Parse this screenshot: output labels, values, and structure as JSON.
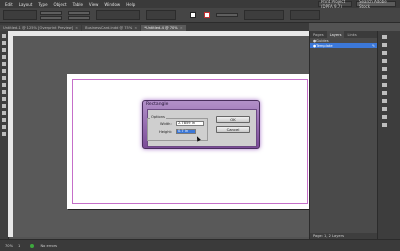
{
  "menubar": {
    "items": [
      "Edit",
      "Layout",
      "Type",
      "Object",
      "Table",
      "View",
      "Window",
      "Help"
    ],
    "workspace": "Print Project (DPFA 9.7)",
    "search_placeholder": "Search Adobe Stock"
  },
  "document_tabs": [
    {
      "label": "Untitled-1 @ 125% [Overprint Preview]",
      "active": false
    },
    {
      "label": "BusinessCard.indd @ 75%",
      "active": false
    },
    {
      "label": "*Untitled-4 @ 70%",
      "active": true
    }
  ],
  "dialog": {
    "title": "Rectangle",
    "options_label": "Options",
    "width_label": "Width:",
    "width_value": "2.7859 in",
    "height_label": "Height:",
    "height_value": "0.7 in",
    "ok_label": "OK",
    "cancel_label": "Cancel"
  },
  "layers_panel": {
    "tabs": [
      "Pages",
      "Layers",
      "Links"
    ],
    "active_tab": "Layers",
    "layers": [
      {
        "name": "Guides",
        "selected": false
      },
      {
        "name": "Template",
        "selected": true
      }
    ],
    "footer": "Page: 1, 2 Layers"
  },
  "statusbar": {
    "zoom": "70%",
    "page": "1",
    "preflight": "No errors"
  },
  "colors": {
    "dialog_accent": "#8a5aa8",
    "selection": "#3c78d8",
    "margin_guide": "#c56fc9"
  }
}
